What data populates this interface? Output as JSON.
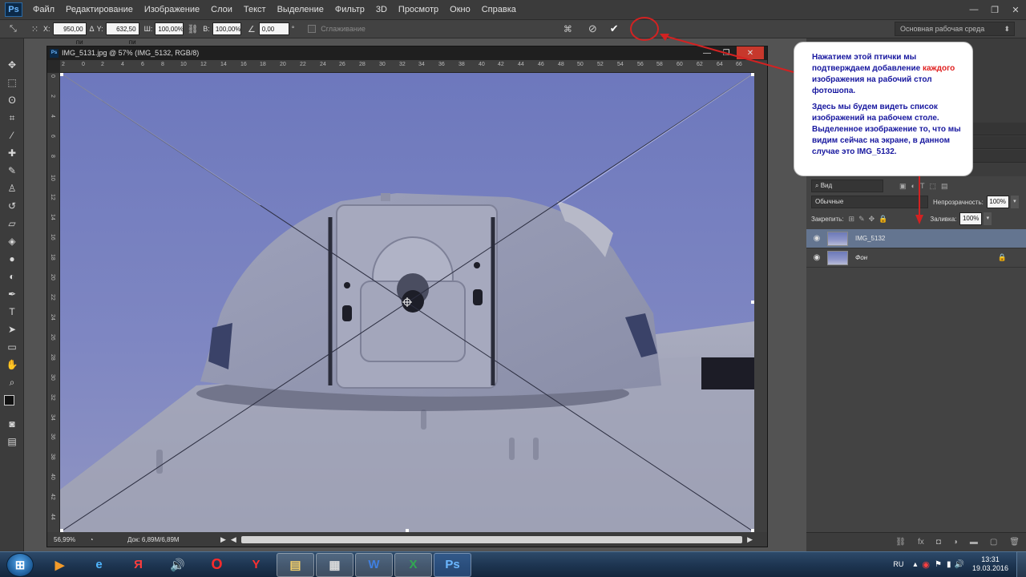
{
  "app": {
    "logo": "Ps"
  },
  "menu": [
    "Файл",
    "Редактирование",
    "Изображение",
    "Слои",
    "Текст",
    "Выделение",
    "Фильтр",
    "3D",
    "Просмотр",
    "Окно",
    "Справка"
  ],
  "window_controls": {
    "min": "—",
    "max": "❐",
    "close": "✕"
  },
  "options": {
    "x_label": "X:",
    "x_value": "950,00 пи",
    "y_label": "Y:",
    "y_value": "632,50 пи",
    "w_label": "Ш:",
    "w_value": "100,00%",
    "h_label": "В:",
    "h_value": "100,00%",
    "angle_value": "0,00",
    "angle_unit": "°",
    "smoothing_label": "Сглаживание",
    "workspace": "Основная рабочая среда"
  },
  "document": {
    "title": "IMG_5131.jpg @ 57% (IMG_5132, RGB/8)",
    "ps_icon": "Ps",
    "zoom": "56,99%",
    "doc_size": "Док: 6,89M/6,89M",
    "h_ruler_labels": [
      "2",
      "0",
      "2",
      "4",
      "6",
      "8",
      "10",
      "12",
      "14",
      "16",
      "18",
      "20",
      "22",
      "24",
      "26",
      "28",
      "30",
      "32",
      "34",
      "36",
      "38",
      "40",
      "42",
      "44",
      "46",
      "48",
      "50",
      "52",
      "54",
      "56",
      "58",
      "60",
      "62",
      "64",
      "66"
    ],
    "v_ruler_labels": [
      "0",
      "2",
      "4",
      "6",
      "8",
      "10",
      "12",
      "14",
      "16",
      "18",
      "20",
      "22",
      "24",
      "26",
      "28",
      "30",
      "32",
      "34",
      "36",
      "38",
      "40",
      "42",
      "44"
    ]
  },
  "layers_panel": {
    "search_placeholder": "Вид",
    "blend_mode": "Обычные",
    "opacity_label": "Непрозрачность:",
    "opacity_value": "100%",
    "lock_label": "Закрепить:",
    "fill_label": "Заливка:",
    "fill_value": "100%",
    "layers": [
      {
        "name": "IMG_5132",
        "selected": true
      },
      {
        "name": "Фон",
        "selected": false,
        "locked": true
      }
    ]
  },
  "callout": {
    "para1_before": "Нажатием этой птички мы подтверждаем добавление ",
    "para1_red": "каждого",
    "para1_after": " изображения на рабочий стол фотошопа.",
    "para2": "Здесь мы будем видеть список изображений на рабочем столе. Выделенное изображение то, что мы видим сейчас на экране, в данном случае это IMG_5132."
  },
  "taskbar": {
    "language": "RU",
    "time": "13:31",
    "date": "19.03.2016",
    "apps": [
      "media-player",
      "internet-explorer",
      "yandex",
      "sound",
      "opera",
      "yandex-browser",
      "explorer",
      "terminal",
      "word",
      "excel",
      "photoshop"
    ]
  },
  "colors": {
    "accent": "#e02020",
    "callout_text": "#17179f",
    "selected_layer": "#647590"
  }
}
